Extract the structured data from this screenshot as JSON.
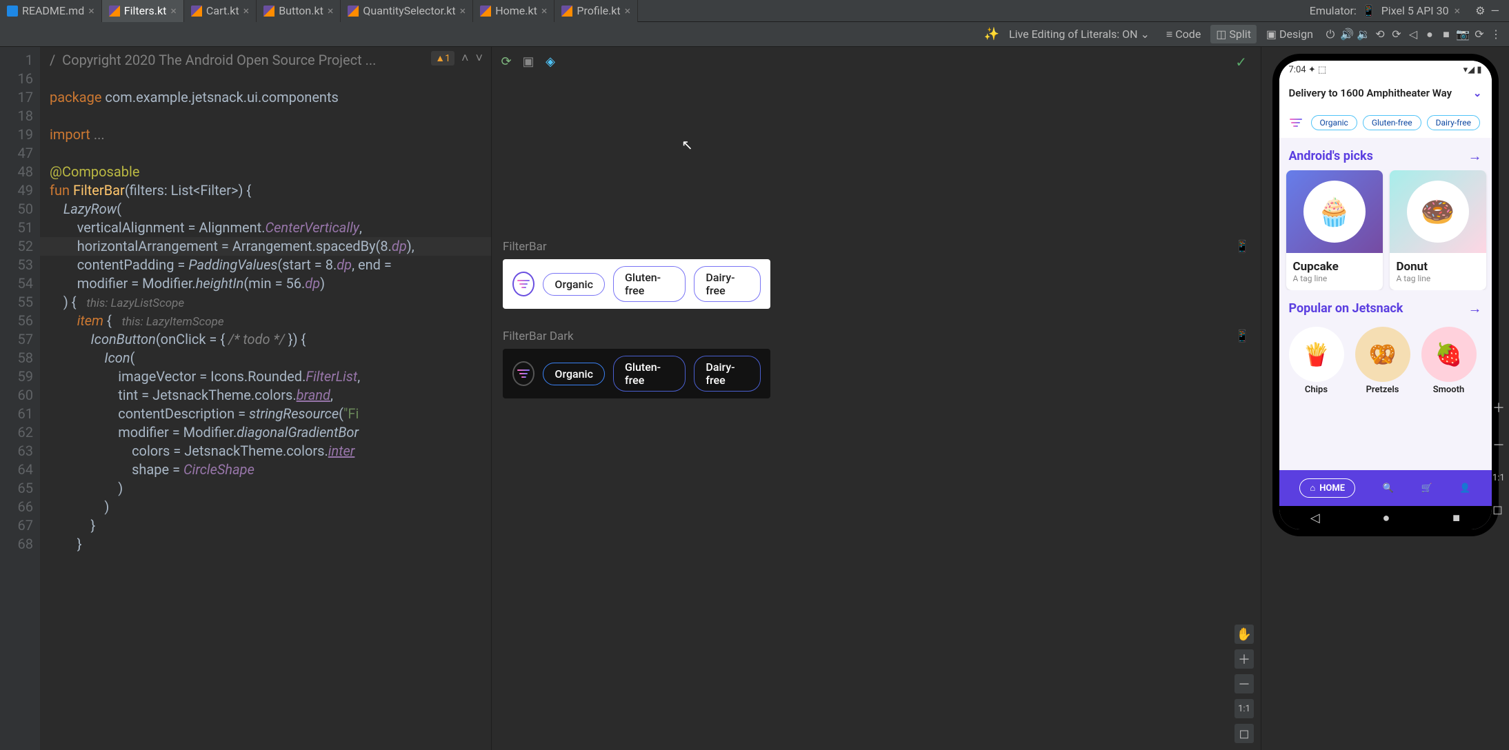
{
  "tabs": [
    {
      "name": "README.md",
      "type": "md"
    },
    {
      "name": "Filters.kt",
      "type": "kt",
      "active": true
    },
    {
      "name": "Cart.kt",
      "type": "kt"
    },
    {
      "name": "Button.kt",
      "type": "kt"
    },
    {
      "name": "QuantitySelector.kt",
      "type": "kt"
    },
    {
      "name": "Home.kt",
      "type": "kt"
    },
    {
      "name": "Profile.kt",
      "type": "kt"
    }
  ],
  "emulator": {
    "label": "Emulator:",
    "device": "Pixel 5 API 30"
  },
  "toolbar": {
    "live_edit": "Live Editing of Literals: ON",
    "code": "Code",
    "split": "Split",
    "design": "Design"
  },
  "gutter": [
    "1",
    "16",
    "17",
    "18",
    "19",
    "47",
    "48",
    "49",
    "50",
    "51",
    "52",
    "53",
    "54",
    "55",
    "56",
    "57",
    "58",
    "59",
    "60",
    "61",
    "62",
    "63",
    "64",
    "65",
    "66",
    "67",
    "68"
  ],
  "code": {
    "l1_a": "/  Copyright 2020 The Android Open Source Project ...",
    "l2": "",
    "l3_kw": "package",
    "l3_b": " com.example.jetsnack.ui.components",
    "l4": "",
    "l5_kw": "import",
    "l5_b": " ",
    "l5_c": "...",
    "l6": "",
    "l7_ann": "@Composable",
    "l8_kw": "fun ",
    "l8_fn": "FilterBar",
    "l8_b": "(filters: List<Filter>) {",
    "l9_a": "    ",
    "l9_fn": "LazyRow",
    "l9_b": "(",
    "l10_a": "        verticalAlignment = Alignment.",
    "l10_p": "CenterVertically",
    "l10_c": ",",
    "l11_a": "        horizontalArrangement = Arrangement.spacedBy(",
    "l11_n": "8",
    "l11_b": ".",
    "l11_p": "dp",
    "l11_c": "),",
    "l12_a": "        contentPadding = ",
    "l12_fn": "PaddingValues",
    "l12_b": "(start = ",
    "l12_n": "8",
    "l12_c": ".",
    "l12_p": "dp",
    "l12_d": ", end = ",
    "l13_a": "        modifier = Modifier.",
    "l13_fn": "heightIn",
    "l13_b": "(min = ",
    "l13_n": "56",
    "l13_c": ".",
    "l13_p": "dp",
    "l13_d": ")",
    "l14_a": "    ) {   ",
    "l14_h": "this: LazyListScope",
    "l15_a": "        ",
    "l15_fn": "item",
    "l15_b": " {   ",
    "l15_h": "this: LazyItemScope",
    "l16_a": "            ",
    "l16_fn": "IconButton",
    "l16_b": "(onClick = { ",
    "l16_com": "/* todo */",
    "l16_c": " }) {",
    "l17_a": "                ",
    "l17_fn": "Icon",
    "l17_b": "(",
    "l18_a": "                    imageVector = Icons.Rounded.",
    "l18_p": "FilterList",
    "l18_b": ",",
    "l19_a": "                    tint = JetsnackTheme.colors.",
    "l19_p": "brand",
    "l19_b": ",",
    "l20_a": "                    contentDescription = ",
    "l20_fn": "stringResource",
    "l20_b": "(",
    "l20_s": "\"Fi",
    "l21_a": "                    modifier = Modifier.",
    "l21_fn": "diagonalGradientBor",
    "l22_a": "                        colors = JetsnackTheme.colors.",
    "l22_p": "inter",
    "l23_a": "                        shape = ",
    "l23_p": "CircleShape",
    "l24": "                    )",
    "l25": "                )",
    "l26": "            }",
    "l27": "        }"
  },
  "code_badge": "1",
  "preview": {
    "label1": "FilterBar",
    "label2": "FilterBar Dark",
    "chips": [
      "Organic",
      "Gluten-free",
      "Dairy-free"
    ]
  },
  "device": {
    "time": "7:04",
    "delivery": "Delivery to 1600 Amphitheater Way",
    "chips": [
      "Organic",
      "Gluten-free",
      "Dairy-free"
    ],
    "section1": "Android's picks",
    "cards": [
      {
        "title": "Cupcake",
        "sub": "A tag line",
        "emoji": "🧁"
      },
      {
        "title": "Donut",
        "sub": "A tag line",
        "emoji": "🍩"
      }
    ],
    "section2": "Popular on Jetsnack",
    "round": [
      {
        "label": "Chips",
        "emoji": "🍟"
      },
      {
        "label": "Pretzels",
        "emoji": "🥨"
      },
      {
        "label": "Smooth",
        "emoji": "🍓"
      }
    ],
    "nav_home": "HOME"
  },
  "zoom": {
    "ratio": "1:1"
  }
}
